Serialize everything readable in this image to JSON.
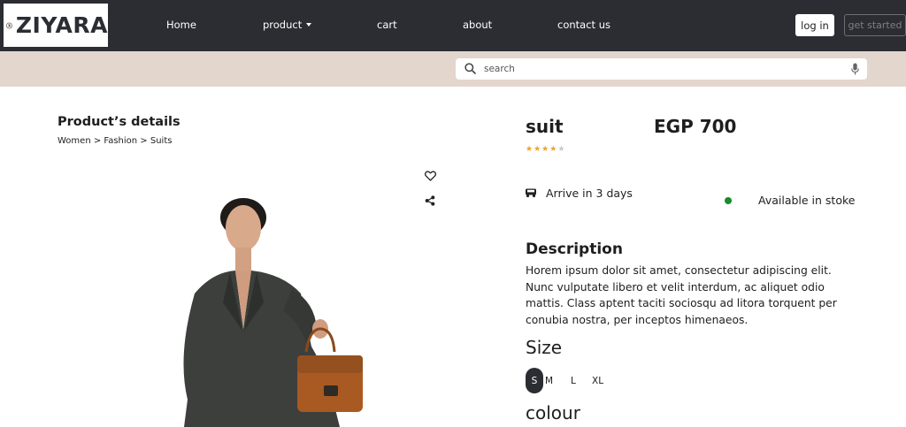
{
  "brand": {
    "name": "ZIYARA"
  },
  "nav": {
    "links": [
      "Home",
      "product",
      "cart",
      "about",
      "contact us"
    ],
    "login_label": "log in",
    "get_started_label": "get started"
  },
  "search": {
    "placeholder": "search"
  },
  "details": {
    "title": "Product’s details",
    "breadcrumb": "Women > Fashion > Suits"
  },
  "product": {
    "name": "suit",
    "price": "EGP 700",
    "rating": {
      "value": 4,
      "max": 5
    },
    "delivery": "Arrive in 3 days",
    "stock": "Available in stoke",
    "description_heading": "Description",
    "description": "Horem ipsum dolor sit amet, consectetur adipiscing elit. Nunc vulputate libero et velit interdum, ac aliquet odio mattis. Class aptent taciti sociosqu ad litora torquent per conubia nostra, per inceptos himenaeos.",
    "size_heading": "Size",
    "sizes": [
      "S",
      "M",
      "L",
      "XL"
    ],
    "selected_size": "S",
    "colour_heading": "colour"
  },
  "colors": {
    "navbar": "#2b2d33",
    "search_band": "#e3d6cd",
    "star": "#f0a22e",
    "stock_dot": "#1a8a2a"
  },
  "icons": [
    "logo-mark-icon",
    "search-icon",
    "microphone-icon",
    "heart-icon",
    "share-icon",
    "truck-icon",
    "star-icon"
  ]
}
